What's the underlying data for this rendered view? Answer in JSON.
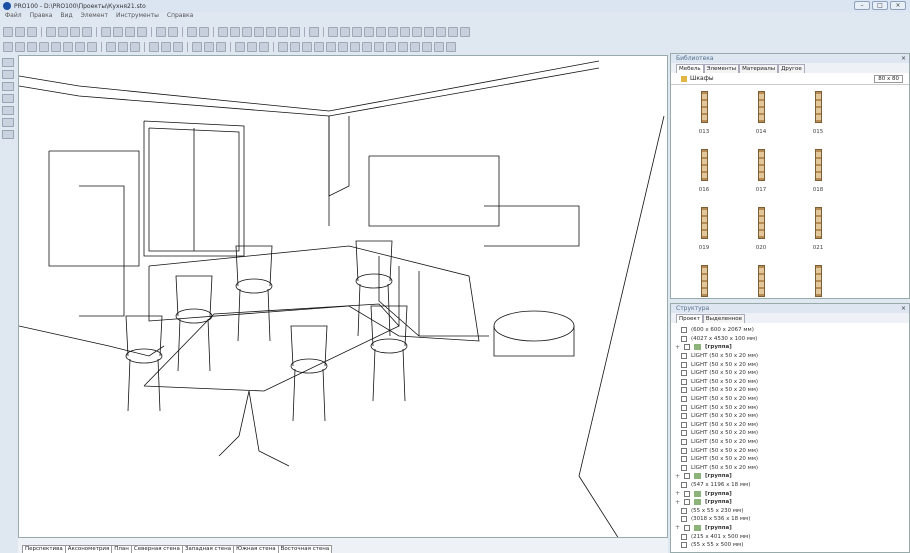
{
  "window": {
    "title": "PRO100 - D:\\PRO100\\Проекты\\Кухня21.sto"
  },
  "menu": [
    "Файл",
    "Правка",
    "Вид",
    "Элемент",
    "Инструменты",
    "Справка"
  ],
  "viewport": {
    "tabs": [
      "Перспектива",
      "Аксонометрия",
      "План",
      "Северная стена",
      "Западная стена",
      "Южная стена",
      "Восточная стена"
    ]
  },
  "library": {
    "title": "Библиотека",
    "tabs": [
      "Мебель",
      "Элементы",
      "Материалы",
      "Другое"
    ],
    "folder": "Шкафы",
    "thumb_size": "80 x 80",
    "items": [
      "013",
      "014",
      "015",
      "016",
      "017",
      "018",
      "019",
      "020",
      "021",
      "",
      "",
      " "
    ]
  },
  "structure": {
    "title": "Структура",
    "tabs": [
      "Проект",
      "Выделенное"
    ],
    "rows": [
      {
        "t": "(600 x 600 x 2067 мм)"
      },
      {
        "t": "(4027 x 4530 x 100 мм)"
      },
      {
        "t": "[группа]",
        "g": true
      },
      {
        "t": "LIGHT   (50 x 50 x 20 мм)"
      },
      {
        "t": "LIGHT   (50 x 50 x 20 мм)"
      },
      {
        "t": "LIGHT   (50 x 50 x 20 мм)"
      },
      {
        "t": "LIGHT   (50 x 50 x 20 мм)"
      },
      {
        "t": "LIGHT   (50 x 50 x 20 мм)"
      },
      {
        "t": "LIGHT   (50 x 50 x 20 мм)"
      },
      {
        "t": "LIGHT   (50 x 50 x 20 мм)"
      },
      {
        "t": "LIGHT   (50 x 50 x 20 мм)"
      },
      {
        "t": "LIGHT   (50 x 50 x 20 мм)"
      },
      {
        "t": "LIGHT   (50 x 50 x 20 мм)"
      },
      {
        "t": "LIGHT   (50 x 50 x 20 мм)"
      },
      {
        "t": "LIGHT   (50 x 50 x 20 мм)"
      },
      {
        "t": "LIGHT   (50 x 50 x 20 мм)"
      },
      {
        "t": "LIGHT   (50 x 50 x 20 мм)"
      },
      {
        "t": "[группа]",
        "g": true
      },
      {
        "t": "(547 x 1196 x 18 мм)"
      },
      {
        "t": "[группа]",
        "g": true
      },
      {
        "t": "[группа]",
        "g": true
      },
      {
        "t": "(55 x 55 x 230 мм)"
      },
      {
        "t": "(3018 x 536 x 18 мм)"
      },
      {
        "t": "[группа]",
        "g": true
      },
      {
        "t": "(215 x 401 x 500 мм)"
      },
      {
        "t": "(55 x 55 x 500 мм)"
      }
    ]
  }
}
